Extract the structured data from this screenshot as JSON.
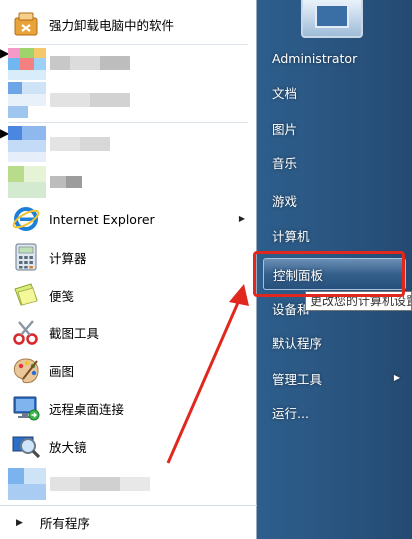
{
  "left_pane": {
    "pinned_top": {
      "label": "强力卸载电脑中的软件"
    },
    "programs": [
      {
        "label": "Internet Explorer",
        "icon": "internet-explorer-icon",
        "has_submenu": true
      },
      {
        "label": "计算器",
        "icon": "calculator-icon",
        "has_submenu": false
      },
      {
        "label": "便笺",
        "icon": "sticky-notes-icon",
        "has_submenu": false
      },
      {
        "label": "截图工具",
        "icon": "snipping-tool-icon",
        "has_submenu": false
      },
      {
        "label": "画图",
        "icon": "paint-palette-icon",
        "has_submenu": false
      },
      {
        "label": "远程桌面连接",
        "icon": "remote-desktop-icon",
        "has_submenu": false
      },
      {
        "label": "放大镜",
        "icon": "magnifier-icon",
        "has_submenu": false
      }
    ],
    "all_programs": "所有程序"
  },
  "right_pane": {
    "items": [
      {
        "label": "Administrator"
      },
      {
        "label": "文档"
      },
      {
        "label": "图片"
      },
      {
        "label": "音乐"
      },
      {
        "label": "游戏"
      },
      {
        "label": "计算机"
      },
      {
        "label": "控制面板"
      },
      {
        "label": "设备和"
      },
      {
        "label": "默认程序"
      },
      {
        "label": "管理工具"
      },
      {
        "label": "运行..."
      }
    ],
    "tooltip": "更改您的计算机设置"
  },
  "colors": {
    "annotation": "#e0281e",
    "right_pane": "#2b5783"
  }
}
